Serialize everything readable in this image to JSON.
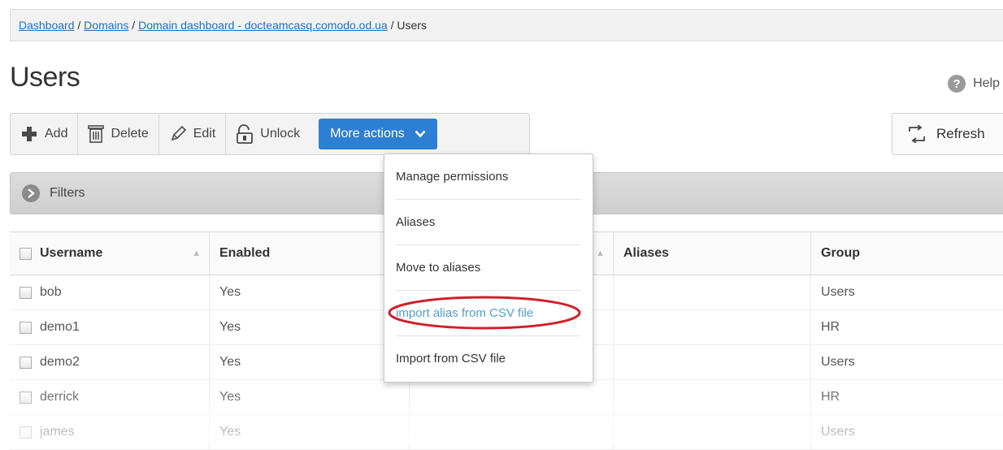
{
  "breadcrumb": {
    "items": [
      "Dashboard",
      "Domains",
      "Domain dashboard - docteamcasq.comodo.od.ua"
    ],
    "separator": " / ",
    "current": "Users"
  },
  "page": {
    "title": "Users"
  },
  "help": {
    "label": "Help",
    "icon_glyph": "?",
    "icon": "question-circle-icon"
  },
  "toolbar": {
    "add_label": "Add",
    "delete_label": "Delete",
    "edit_label": "Edit",
    "unlock_label": "Unlock",
    "more_actions_label": "More actions"
  },
  "refresh": {
    "label": "Refresh"
  },
  "filters": {
    "label": "Filters"
  },
  "table": {
    "columns": [
      "Username",
      "Enabled",
      "",
      "Aliases",
      "Group"
    ],
    "rows": [
      {
        "username": "bob",
        "enabled": "Yes",
        "aliases": "",
        "group": "Users"
      },
      {
        "username": "demo1",
        "enabled": "Yes",
        "aliases": "",
        "group": "HR"
      },
      {
        "username": "demo2",
        "enabled": "Yes",
        "aliases": "",
        "group": "Users"
      },
      {
        "username": "derrick",
        "enabled": "Yes",
        "aliases": "",
        "group": "HR"
      },
      {
        "username": "james",
        "enabled": "Yes",
        "aliases": "",
        "group": "Users"
      }
    ]
  },
  "dropdown": {
    "items": [
      "Manage permissions",
      "Aliases",
      "Move to aliases",
      "import alias from CSV file",
      "Import from CSV file"
    ],
    "highlighted_index": 3
  },
  "colors": {
    "accent": "#2d7fd4",
    "link": "#2a6db5",
    "highlight_text": "#4aa3d8",
    "annotation": "#d0202a"
  }
}
